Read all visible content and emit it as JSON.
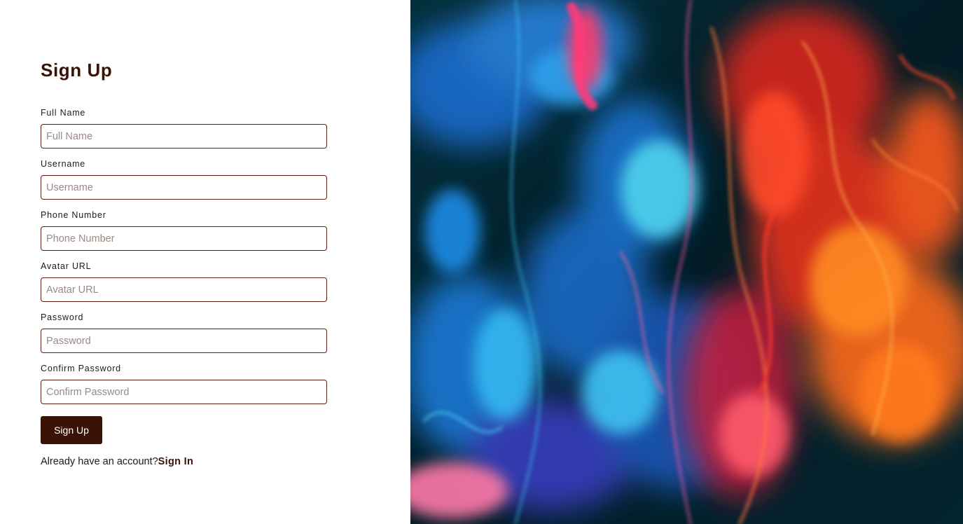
{
  "form": {
    "title": "Sign Up",
    "fields": [
      {
        "label": "Full Name",
        "placeholder": "Full Name",
        "value": ""
      },
      {
        "label": "Username",
        "placeholder": "Username",
        "value": ""
      },
      {
        "label": "Phone Number",
        "placeholder": "Phone Number",
        "value": ""
      },
      {
        "label": "Avatar URL",
        "placeholder": "Avatar URL",
        "value": ""
      },
      {
        "label": "Password",
        "placeholder": "Password",
        "value": ""
      },
      {
        "label": "Confirm Password",
        "placeholder": "Confirm Password",
        "value": ""
      }
    ],
    "submit_label": "Sign Up",
    "signin_prompt": "Already have an account?",
    "signin_link": "Sign In"
  },
  "hero": {
    "image_subject": "abstract-ink-in-water",
    "colors": {
      "background": "#02222c",
      "blue": "#1e90e8",
      "cyan": "#39c6ee",
      "red": "#ff3b2e",
      "orange": "#ff7a1a",
      "pink": "#ff5aa8"
    }
  },
  "colors": {
    "accent": "#3a1206",
    "input_border": "#5c1f0d",
    "text": "#1f1a17"
  }
}
